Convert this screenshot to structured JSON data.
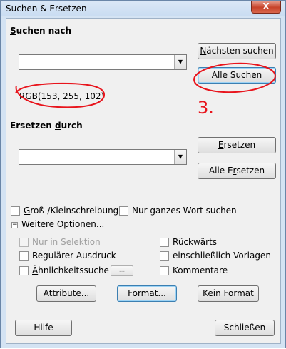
{
  "window": {
    "title": "Suchen & Ersetzen",
    "close_glyph": "X"
  },
  "search": {
    "section_label_pre": "",
    "section_label_u": "S",
    "section_label_post": "uchen nach",
    "input_value": "",
    "selected_format": "RGB(153, 255, 102)",
    "find_next_pre": "",
    "find_next_u": "N",
    "find_next_post": "ächsten suchen",
    "find_all_label": "Alle Suchen"
  },
  "replace": {
    "section_label_pre": "Ersetzen ",
    "section_label_u": "d",
    "section_label_post": "urch",
    "input_value": "",
    "replace_pre": "",
    "replace_u": "E",
    "replace_post": "rsetzen",
    "replace_all_pre": "Alle E",
    "replace_all_u": "r",
    "replace_all_post": "setzen"
  },
  "options": {
    "match_case_pre": "",
    "match_case_u": "G",
    "match_case_post": "roß-/Kleinschreibung",
    "whole_word": "Nur ganzes Wort suchen",
    "more_options_pre": "Weitere ",
    "more_options_u": "O",
    "more_options_post": "ptionen...",
    "selection_only": "Nur in Selektion",
    "backwards_pre": "R",
    "backwards_u": "ü",
    "backwards_post": "ckwärts",
    "regex": "Regulärer Ausdruck",
    "include_styles": "einschließlich Vorlagen",
    "similarity_pre": "",
    "similarity_u": "Ä",
    "similarity_post": "hnlichkeitssuche",
    "similarity_btn": "...",
    "comments": "Kommentare"
  },
  "buttons": {
    "attributes": "Attribute...",
    "format": "Format...",
    "no_format": "Kein Format",
    "help": "Hilfe",
    "close": "Schließen"
  },
  "annotation": {
    "step_label": "3.",
    "color": "#e8141c"
  },
  "colors": {
    "focus_border": "#3c7fb1",
    "window_frame": "#d4e3f3"
  }
}
